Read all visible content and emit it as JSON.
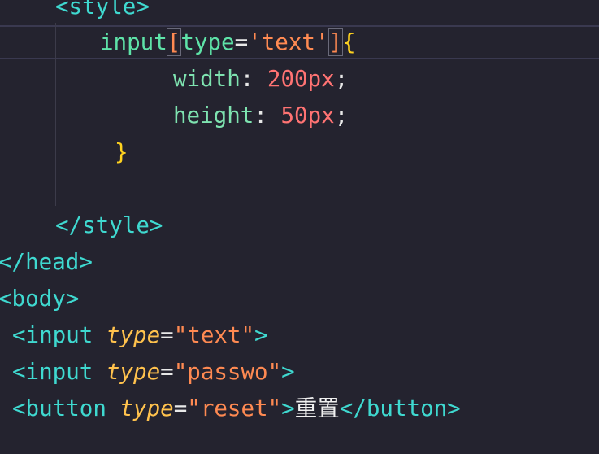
{
  "code": {
    "line1": {
      "tag": "<style>"
    },
    "line2": {
      "selector": "input",
      "open_bracket": "[",
      "attr": "type",
      "eq": "=",
      "value": "'text'",
      "close_bracket": "]",
      "brace": "{"
    },
    "line3": {
      "prop": "width",
      "colon": ": ",
      "value": "200px",
      "semi": ";"
    },
    "line4": {
      "prop": "height",
      "colon": ": ",
      "value": "50px",
      "semi": ";"
    },
    "line5": {
      "brace": "}"
    },
    "line7": {
      "tag": "</style>"
    },
    "line8": {
      "tag": "</head>"
    },
    "line9": {
      "tag": "<body>"
    },
    "line10": {
      "open": "<input",
      "attr": "type",
      "eq": "=",
      "value": "\"text\"",
      "close": ">"
    },
    "line11": {
      "open": "<input",
      "attr": "type",
      "eq": "=",
      "value": "\"passwo\"",
      "close": ">"
    },
    "line12": {
      "open": "<button",
      "attr": "type",
      "eq": "=",
      "value": "\"reset\"",
      "gt": ">",
      "text": "重置",
      "close": "</button>"
    }
  }
}
